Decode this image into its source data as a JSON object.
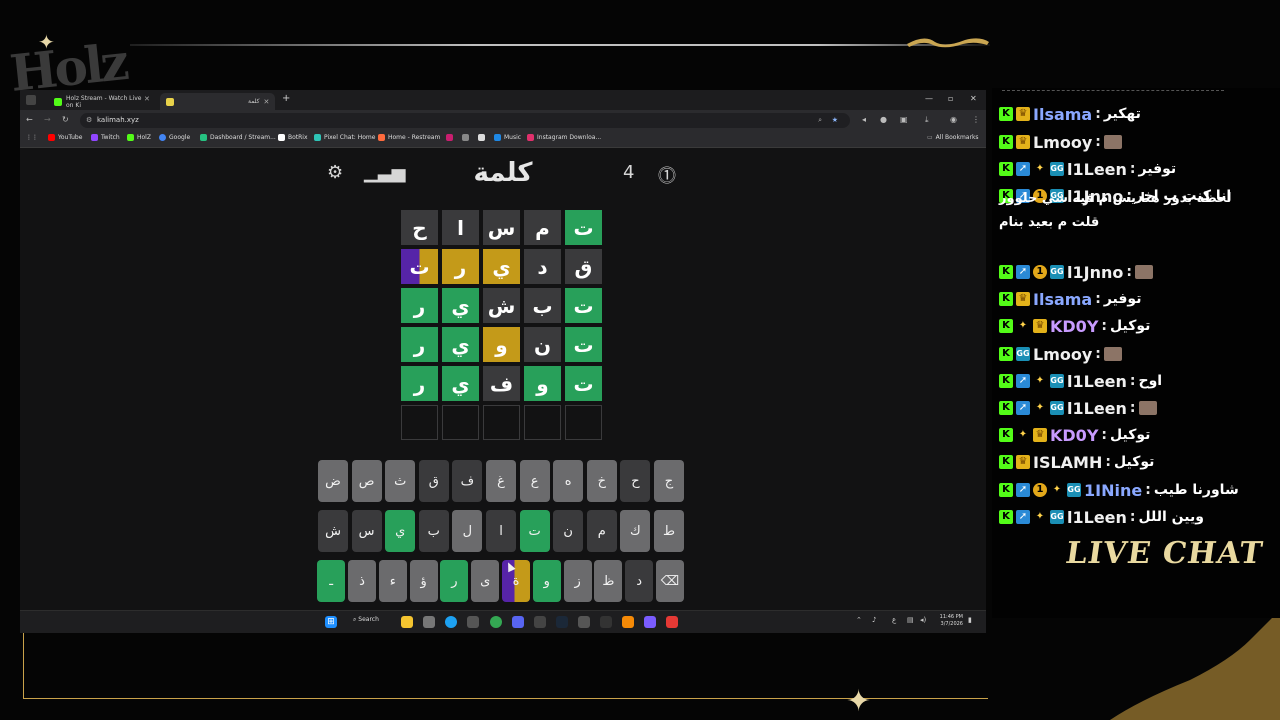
{
  "stream": {
    "logo": "Holz",
    "live_chat_label": "LIVE CHAT"
  },
  "browser": {
    "tabs": [
      {
        "title": "Holz Stream - Watch Live on Ki",
        "active": false
      },
      {
        "title": "كلمة",
        "active": true
      }
    ],
    "url": "kalimah.xyz",
    "bookmarks": [
      "YouTube",
      "Twitch",
      "HolZ",
      "Google",
      "Dashboard / Stream...",
      "BotRix",
      "Pixel Chat: Home",
      "Home - Restream",
      "Music",
      "Instagram Downloa..."
    ],
    "all_bookmarks": "All Bookmarks"
  },
  "game": {
    "title": "كلمة",
    "streak": "4",
    "board": [
      [
        {
          "l": "ت",
          "s": "green"
        },
        {
          "l": "م",
          "s": "gray"
        },
        {
          "l": "س",
          "s": "gray"
        },
        {
          "l": "ا",
          "s": "gray"
        },
        {
          "l": "ح",
          "s": "gray"
        }
      ],
      [
        {
          "l": "ق",
          "s": "gray"
        },
        {
          "l": "د",
          "s": "gray"
        },
        {
          "l": "ي",
          "s": "yellow"
        },
        {
          "l": "ر",
          "s": "yellow"
        },
        {
          "l": "ت",
          "s": "split"
        }
      ],
      [
        {
          "l": "ت",
          "s": "green"
        },
        {
          "l": "ب",
          "s": "gray"
        },
        {
          "l": "ش",
          "s": "gray"
        },
        {
          "l": "ي",
          "s": "green"
        },
        {
          "l": "ر",
          "s": "green"
        }
      ],
      [
        {
          "l": "ت",
          "s": "green"
        },
        {
          "l": "ن",
          "s": "gray"
        },
        {
          "l": "و",
          "s": "yellow"
        },
        {
          "l": "ي",
          "s": "green"
        },
        {
          "l": "ر",
          "s": "green"
        }
      ],
      [
        {
          "l": "ت",
          "s": "green"
        },
        {
          "l": "و",
          "s": "green"
        },
        {
          "l": "ف",
          "s": "gray"
        },
        {
          "l": "ي",
          "s": "green"
        },
        {
          "l": "ر",
          "s": "green"
        }
      ],
      [
        {
          "l": "",
          "s": "empty"
        },
        {
          "l": "",
          "s": "empty"
        },
        {
          "l": "",
          "s": "empty"
        },
        {
          "l": "",
          "s": "empty"
        },
        {
          "l": "",
          "s": "empty"
        }
      ]
    ],
    "keyboard": [
      [
        {
          "k": "ج",
          "s": "unused"
        },
        {
          "k": "ح",
          "s": "absent"
        },
        {
          "k": "خ",
          "s": "unused"
        },
        {
          "k": "ه",
          "s": "unused"
        },
        {
          "k": "ع",
          "s": "unused"
        },
        {
          "k": "غ",
          "s": "unused"
        },
        {
          "k": "ف",
          "s": "absent"
        },
        {
          "k": "ق",
          "s": "absent"
        },
        {
          "k": "ث",
          "s": "unused"
        },
        {
          "k": "ص",
          "s": "unused"
        },
        {
          "k": "ض",
          "s": "unused"
        }
      ],
      [
        {
          "k": "ط",
          "s": "unused"
        },
        {
          "k": "ك",
          "s": "unused"
        },
        {
          "k": "م",
          "s": "absent"
        },
        {
          "k": "ن",
          "s": "absent"
        },
        {
          "k": "ت",
          "s": "correct"
        },
        {
          "k": "ا",
          "s": "absent"
        },
        {
          "k": "ل",
          "s": "unused"
        },
        {
          "k": "ب",
          "s": "absent"
        },
        {
          "k": "ي",
          "s": "correct"
        },
        {
          "k": "س",
          "s": "absent"
        },
        {
          "k": "ش",
          "s": "absent"
        }
      ],
      [
        {
          "k": "⌫",
          "s": "unused"
        },
        {
          "k": "د",
          "s": "absent"
        },
        {
          "k": "ظ",
          "s": "unused"
        },
        {
          "k": "ز",
          "s": "unused"
        },
        {
          "k": "و",
          "s": "correct"
        },
        {
          "k": "ة",
          "s": "split"
        },
        {
          "k": "ى",
          "s": "unused"
        },
        {
          "k": "ر",
          "s": "correct"
        },
        {
          "k": "ؤ",
          "s": "unused"
        },
        {
          "k": "ء",
          "s": "unused"
        },
        {
          "k": "ذ",
          "s": "unused"
        },
        {
          "k": "ـ",
          "s": "correct"
        }
      ]
    ]
  },
  "taskbar": {
    "search": "Search",
    "time": "11:46 PM",
    "date": "3/7/2026",
    "lang": "ع"
  },
  "chat": {
    "messages": [
      {
        "user": "Ilsama",
        "color": "#8aa8ff",
        "badges": [
          "k",
          "crown"
        ],
        "text": "تهكير"
      },
      {
        "user": "Lmooy",
        "color": "#f0f0f0",
        "badges": [
          "k",
          "crown"
        ],
        "text": "",
        "emote": true
      },
      {
        "user": "l1Leen",
        "color": "#f0f0f0",
        "badges": [
          "k",
          "sub",
          "vip",
          "gift"
        ],
        "text": "توفير"
      },
      {
        "user": "l1Jnno",
        "color": "#f0f0f0",
        "badges": [
          "k",
          "sub",
          "one",
          "gift"
        ],
        "text": "انا كنت ب اخر"
      },
      {
        "user": "l1Jnno",
        "color": "#f0f0f0",
        "badges": [
          "k",
          "sub",
          "one",
          "gift"
        ],
        "text": "",
        "emote": true
      },
      {
        "user": "Ilsama",
        "color": "#8aa8ff",
        "badges": [
          "k",
          "crown"
        ],
        "text": "توفير"
      },
      {
        "user": "KD0Y",
        "color": "#c89bff",
        "badges": [
          "k",
          "vip",
          "crown"
        ],
        "text": "توكيل"
      },
      {
        "user": "Lmooy",
        "color": "#f0f0f0",
        "badges": [
          "k",
          "gift"
        ],
        "text": "",
        "emote": true
      },
      {
        "user": "l1Leen",
        "color": "#f0f0f0",
        "badges": [
          "k",
          "sub",
          "vip",
          "gift"
        ],
        "text": "اوح"
      },
      {
        "user": "l1Leen",
        "color": "#f0f0f0",
        "badges": [
          "k",
          "sub",
          "vip",
          "gift"
        ],
        "text": "",
        "emote": true
      },
      {
        "user": "KD0Y",
        "color": "#c89bff",
        "badges": [
          "k",
          "vip",
          "crown"
        ],
        "text": "توكيل"
      },
      {
        "user": "ISLAMH",
        "color": "#f0f0f0",
        "badges": [
          "k",
          "crown"
        ],
        "text": "توكيل"
      },
      {
        "user": "1INine",
        "color": "#8aa8ff",
        "badges": [
          "k",
          "sub",
          "one",
          "vip",
          "gift"
        ],
        "text": "شاورنا طيب"
      },
      {
        "user": "l1Leen",
        "color": "#f0f0f0",
        "badges": [
          "k",
          "sub",
          "vip",
          "gift"
        ],
        "text": "ويين اللل"
      }
    ],
    "wrapped_lines": [
      "لحظه بدور هنا يس م فيه شي حلوور",
      "قلت م بعيد بنام"
    ]
  }
}
